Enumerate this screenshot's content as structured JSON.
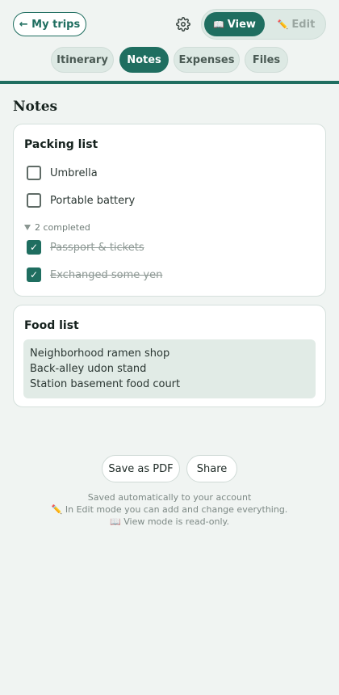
{
  "header": {
    "back_label": "← My trips",
    "settings_icon": "gear-icon",
    "mode_view": "View",
    "mode_edit": "Edit",
    "view_icon": "📖",
    "edit_icon": "✏️"
  },
  "tabs": [
    {
      "label": "Itinerary",
      "active": false
    },
    {
      "label": "Notes",
      "active": true
    },
    {
      "label": "Expenses",
      "active": false
    },
    {
      "label": "Files",
      "active": false
    }
  ],
  "page_title": "Notes",
  "packing": {
    "title": "Packing list",
    "open_items": [
      {
        "label": "Umbrella",
        "checked": false
      },
      {
        "label": "Portable battery",
        "checked": false
      }
    ],
    "completed_label": "2 completed",
    "completed_items": [
      {
        "label": "Passport & tickets",
        "checked": true
      },
      {
        "label": "Exchanged some yen",
        "checked": true
      }
    ]
  },
  "food": {
    "title": "Food list",
    "lines": [
      "Neighborhood ramen shop",
      "Back-alley udon stand",
      "Station basement food court"
    ]
  },
  "actions": {
    "save_pdf": "Save as PDF",
    "share": "Share"
  },
  "footer": {
    "line1": "Saved automatically to your account",
    "line2": "In Edit mode you can add and change everything.",
    "line3": "View mode is read-only."
  },
  "colors": {
    "accent": "#1f6e60",
    "background": "#f0f4f2"
  }
}
